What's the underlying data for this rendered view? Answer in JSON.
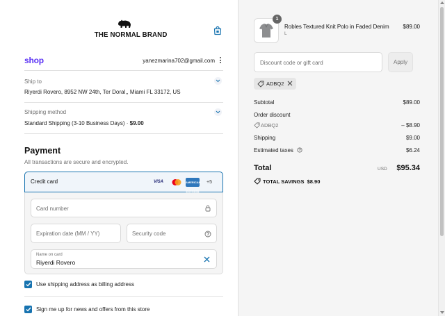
{
  "header": {
    "brand_name": "THE NORMAL BRAND",
    "logo_icon": "bear-logo",
    "cart_icon": "shopping-bag-icon"
  },
  "account": {
    "shop_label": "shop",
    "email": "yanezmarina702@gmail.com"
  },
  "ship_to": {
    "label": "Ship to",
    "value": "Riyerdi Rovero, 8952 NW 24th, Ter Doral,, Miami FL 33172, US"
  },
  "shipping_method": {
    "label": "Shipping method",
    "value": "Standard Shipping (3-10 Business Days) · ",
    "price": "$9.00"
  },
  "payment": {
    "title": "Payment",
    "subtitle": "All transactions are secure and encrypted.",
    "method_label": "Credit card",
    "card_brands": [
      "VISA",
      "Mastercard",
      "AMERICAN EXPRESS"
    ],
    "more_cards": "+5",
    "card_number_placeholder": "Card number",
    "expiration_placeholder": "Expiration date (MM / YY)",
    "security_placeholder": "Security code",
    "name_label": "Name on card",
    "name_value": "Riyerdi Rovero"
  },
  "options": {
    "billing_same": "Use shipping address as billing address",
    "newsletter": "Sign me up for news and offers from this store"
  },
  "product": {
    "quantity": "1",
    "name": "Robles Textured Knit Polo in Faded Denim",
    "variant": "L",
    "price": "$89.00"
  },
  "discount": {
    "placeholder": "Discount code or gift card",
    "apply_label": "Apply",
    "applied_code": "ADBQ2"
  },
  "summary": {
    "subtotal_label": "Subtotal",
    "subtotal_value": "$89.00",
    "order_discount_label": "Order discount",
    "order_discount_code": "ADBQ2",
    "order_discount_value": "– $8.90",
    "shipping_label": "Shipping",
    "shipping_value": "$9.00",
    "taxes_label": "Estimated taxes",
    "taxes_value": "$6.24",
    "total_label": "Total",
    "total_currency": "USD",
    "total_value": "$95.34",
    "savings_label": "TOTAL SAVINGS",
    "savings_value": "$8.90"
  },
  "colors": {
    "accent": "#1773b0",
    "shop_purple": "#5a31f4",
    "summary_bg": "#f5f5f5"
  }
}
